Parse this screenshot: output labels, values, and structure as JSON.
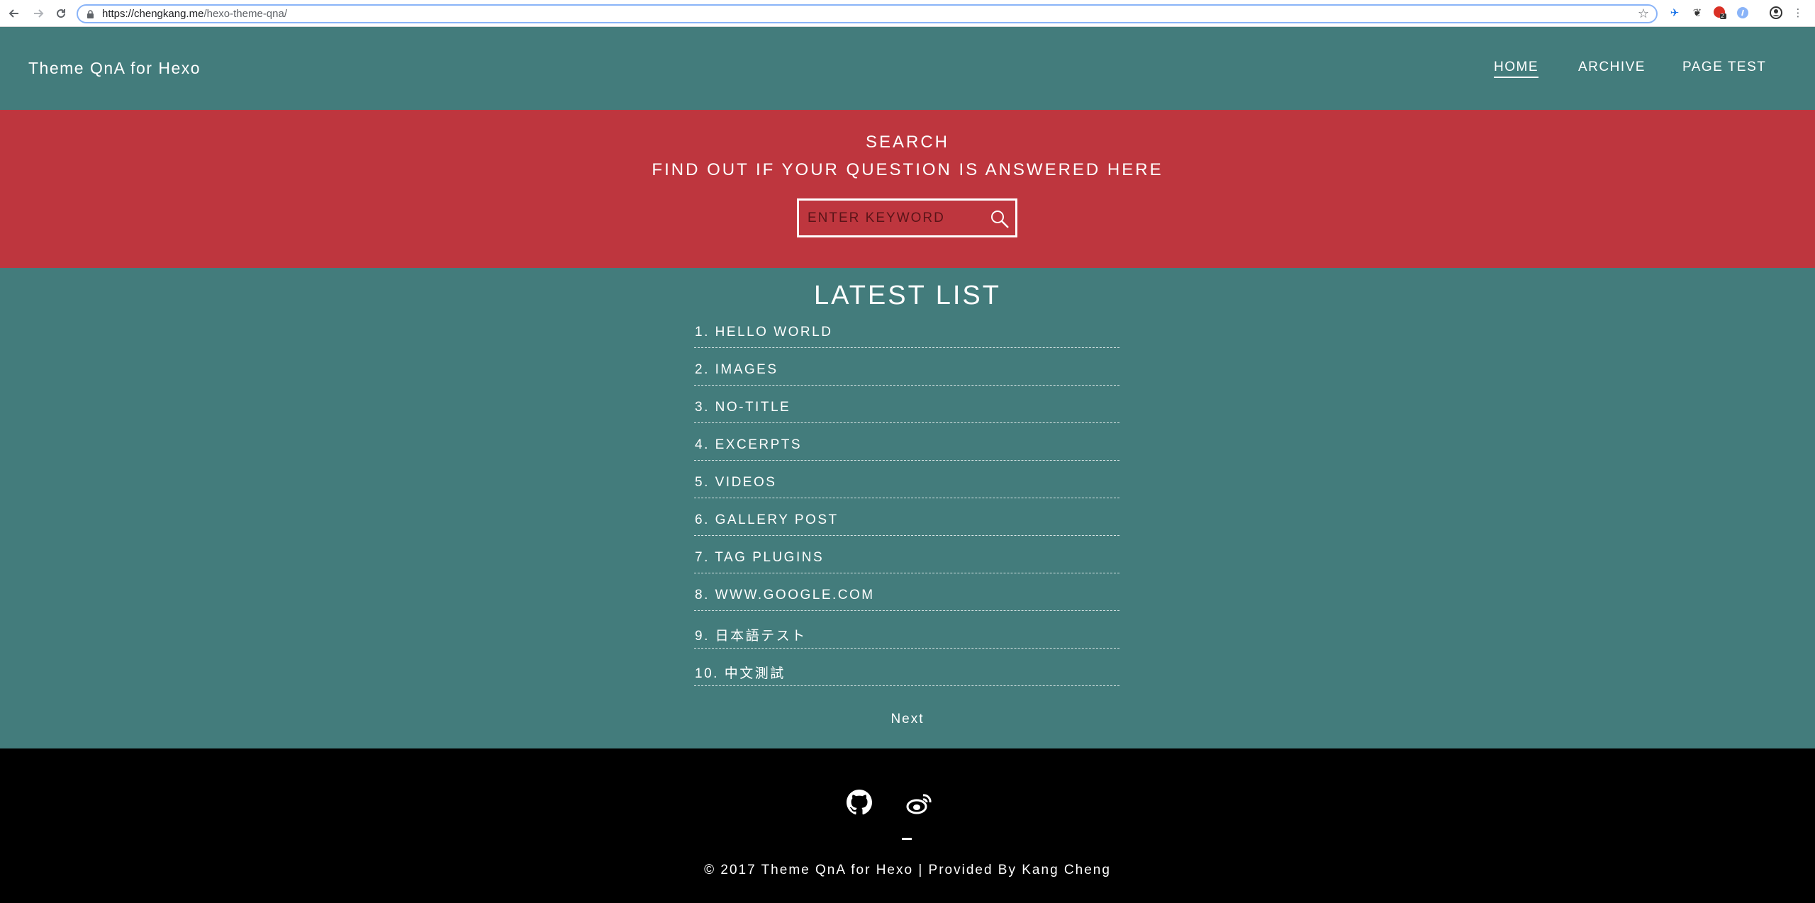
{
  "browser": {
    "url_host": "https://chengkang.me",
    "url_path": "/hexo-theme-qna/",
    "back_icon": "back-arrow-icon",
    "forward_icon": "forward-arrow-icon",
    "reload_icon": "reload-icon",
    "extension_badge": "2"
  },
  "header": {
    "brand": "Theme QnA for Hexo",
    "nav": [
      {
        "label": "HOME",
        "active": true
      },
      {
        "label": "ARCHIVE",
        "active": false
      },
      {
        "label": "PAGE TEST",
        "active": false
      }
    ]
  },
  "search": {
    "title": "SEARCH",
    "subtitle": "FIND OUT IF YOUR QUESTION IS ANSWERED HERE",
    "placeholder": "ENTER KEYWORD",
    "value": ""
  },
  "latest": {
    "title": "LATEST LIST",
    "items": [
      {
        "label": "1. HELLO WORLD"
      },
      {
        "label": "2. IMAGES"
      },
      {
        "label": "3. NO-TITLE"
      },
      {
        "label": "4. EXCERPTS"
      },
      {
        "label": "5. VIDEOS"
      },
      {
        "label": "6. GALLERY POST"
      },
      {
        "label": "7. TAG PLUGINS"
      },
      {
        "label": "8. WWW.GOOGLE.COM"
      },
      {
        "label": "9. 日本語テスト"
      },
      {
        "label": "10. 中文測試"
      }
    ],
    "next_label": "Next"
  },
  "footer": {
    "copyright": "© 2017 Theme QnA for Hexo | Provided By Kang Cheng",
    "social": [
      "github-icon",
      "weibo-icon"
    ]
  },
  "colors": {
    "header_bg": "#437c7c",
    "search_bg": "#be363e",
    "main_bg": "#437c7c",
    "footer_bg": "#000000"
  }
}
